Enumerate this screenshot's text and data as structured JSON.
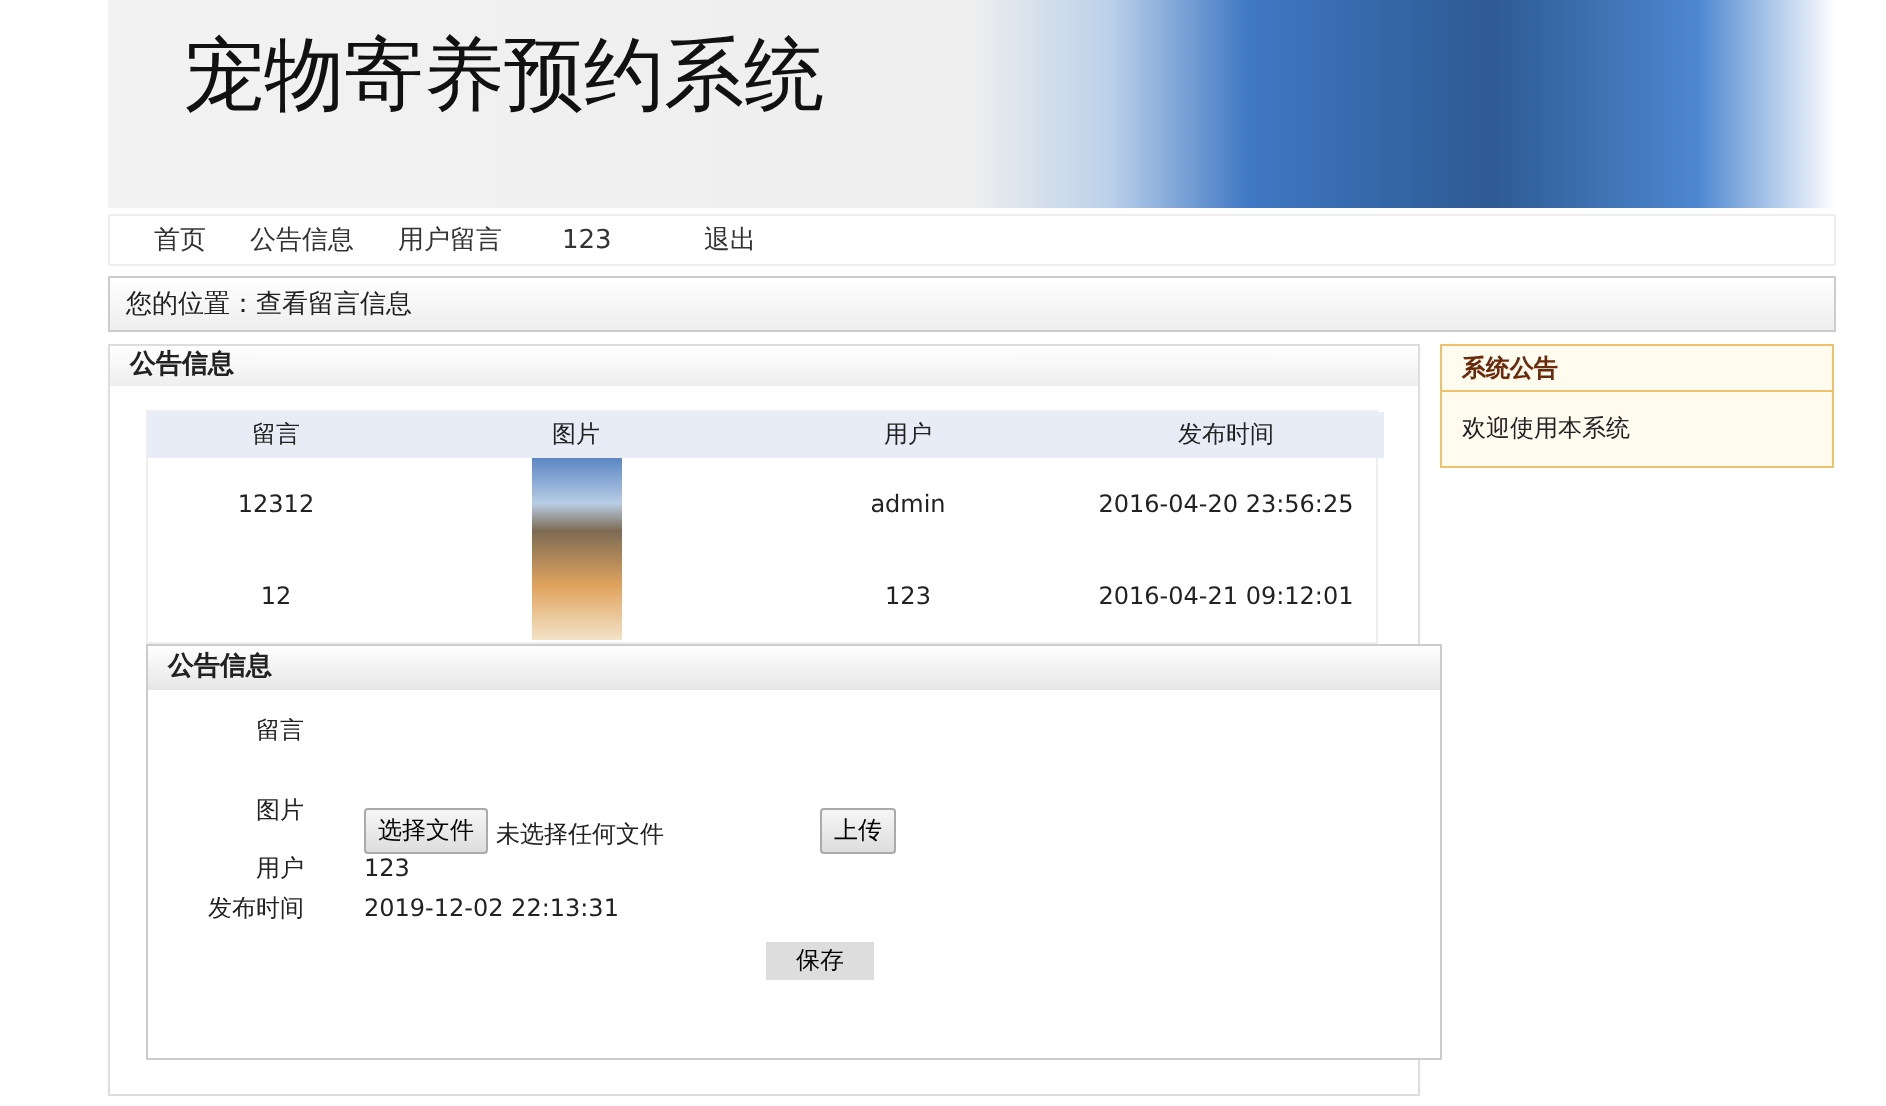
{
  "header": {
    "title": "宠物寄养预约系统"
  },
  "nav": [
    {
      "label": "首页"
    },
    {
      "label": "公告信息"
    },
    {
      "label": "用户留言"
    },
    {
      "label": "123"
    },
    {
      "label": "退出"
    }
  ],
  "breadcrumb": "您的位置：查看留言信息",
  "main": {
    "title": "公告信息",
    "table": {
      "columns": [
        "留言",
        "图片",
        "用户",
        "发布时间"
      ],
      "rows": [
        {
          "message": "12312",
          "photo": true,
          "user": "admin",
          "time": "2016-04-20 23:56:25"
        },
        {
          "message": "12",
          "photo": false,
          "user": "123",
          "time": "2016-04-21 09:12:01"
        }
      ]
    },
    "form": {
      "title": "公告信息",
      "fields": [
        {
          "kind": "empty",
          "label": "留言"
        },
        {
          "kind": "file",
          "label": "图片",
          "button": "选择文件",
          "status": "未选择任何文件",
          "upload": "上传"
        },
        {
          "kind": "text",
          "label": "用户",
          "value": "123"
        },
        {
          "kind": "text",
          "label": "发布时间",
          "value": "2019-12-02 22:13:31"
        }
      ],
      "submit": "保存"
    }
  },
  "sidebar": {
    "title": "系统公告",
    "text": "欢迎使用本系统"
  }
}
